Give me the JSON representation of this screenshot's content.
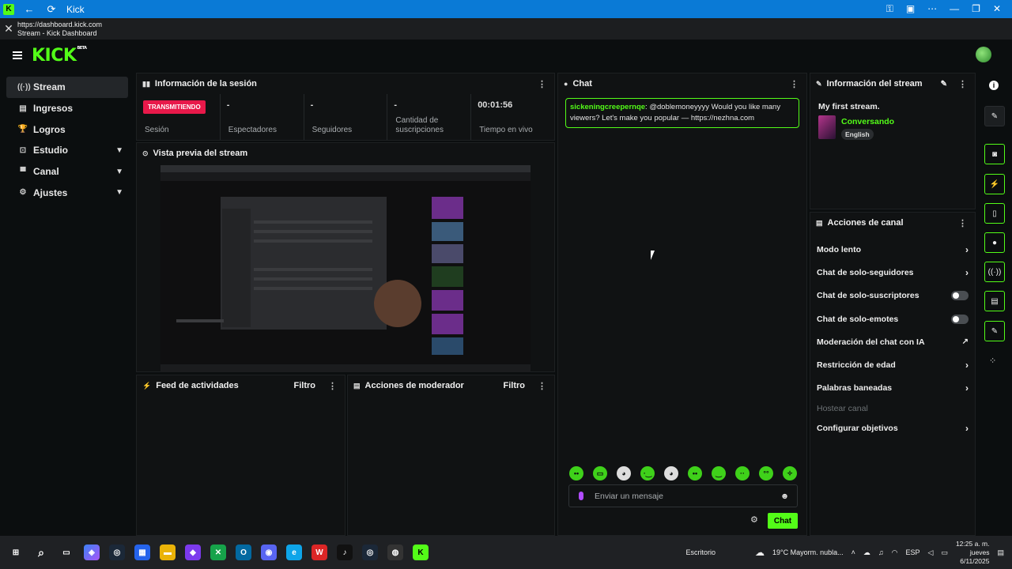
{
  "window": {
    "title": "Kick",
    "url": "https://dashboard.kick.com",
    "page_title": "Stream - Kick Dashboard"
  },
  "brand": {
    "logo": "KICK",
    "beta": "BETA",
    "accent": "#53fc18"
  },
  "sidebar": {
    "items": [
      {
        "label": "Stream",
        "icon": "broadcast-icon",
        "active": true
      },
      {
        "label": "Ingresos",
        "icon": "money-icon"
      },
      {
        "label": "Logros",
        "icon": "trophy-icon"
      },
      {
        "label": "Estudio",
        "icon": "studio-icon",
        "expandable": true
      },
      {
        "label": "Canal",
        "icon": "channel-icon",
        "expandable": true
      },
      {
        "label": "Ajustes",
        "icon": "gear-icon",
        "expandable": true
      }
    ]
  },
  "session": {
    "title": "Información de la sesión",
    "badge": "TRANSMITIENDO",
    "stats": [
      {
        "value": "",
        "label": "Sesión"
      },
      {
        "value": "-",
        "label": "Espectadores"
      },
      {
        "value": "-",
        "label": "Seguidores"
      },
      {
        "value": "-",
        "label": "Cantidad de suscripciones"
      },
      {
        "value": "00:01:56",
        "label": "Tiempo en vivo"
      }
    ]
  },
  "preview": {
    "title": "Vista previa del stream"
  },
  "feed": {
    "title": "Feed de actividades",
    "filter": "Filtro"
  },
  "modactions": {
    "title": "Acciones de moderador",
    "filter": "Filtro"
  },
  "chat": {
    "title": "Chat",
    "messages": [
      {
        "user": "sickeningcreepernqe",
        "text": ": @doblemoneyyyy Would you like many viewers? Let's make you popular — https://nezhna.com"
      }
    ],
    "placeholder": "Enviar un mensaje",
    "send": "Chat"
  },
  "stream_info": {
    "title": "Información del stream",
    "stream_title": "My first stream.",
    "category": "Conversando",
    "language": "English"
  },
  "channel_actions": {
    "title": "Acciones de canal",
    "items": [
      {
        "label": "Modo lento",
        "kind": "arrow"
      },
      {
        "label": "Chat de solo-seguidores",
        "kind": "arrow"
      },
      {
        "label": "Chat de solo-suscriptores",
        "kind": "toggle"
      },
      {
        "label": "Chat de solo-emotes",
        "kind": "toggle"
      },
      {
        "label": "Moderación del chat con IA",
        "kind": "external"
      },
      {
        "label": "Restricción de edad",
        "kind": "arrow"
      },
      {
        "label": "Palabras baneadas",
        "kind": "arrow"
      },
      {
        "label": "Hostear canal",
        "kind": "disabled"
      },
      {
        "label": "Configurar objetivos",
        "kind": "arrow"
      }
    ]
  },
  "taskbar": {
    "desktop": "Escritorio",
    "weather": "19°C  Mayorm. nubla...",
    "lang": "ESP",
    "time": "12:25 a. m.",
    "day": "jueves",
    "date": "6/11/2025"
  }
}
